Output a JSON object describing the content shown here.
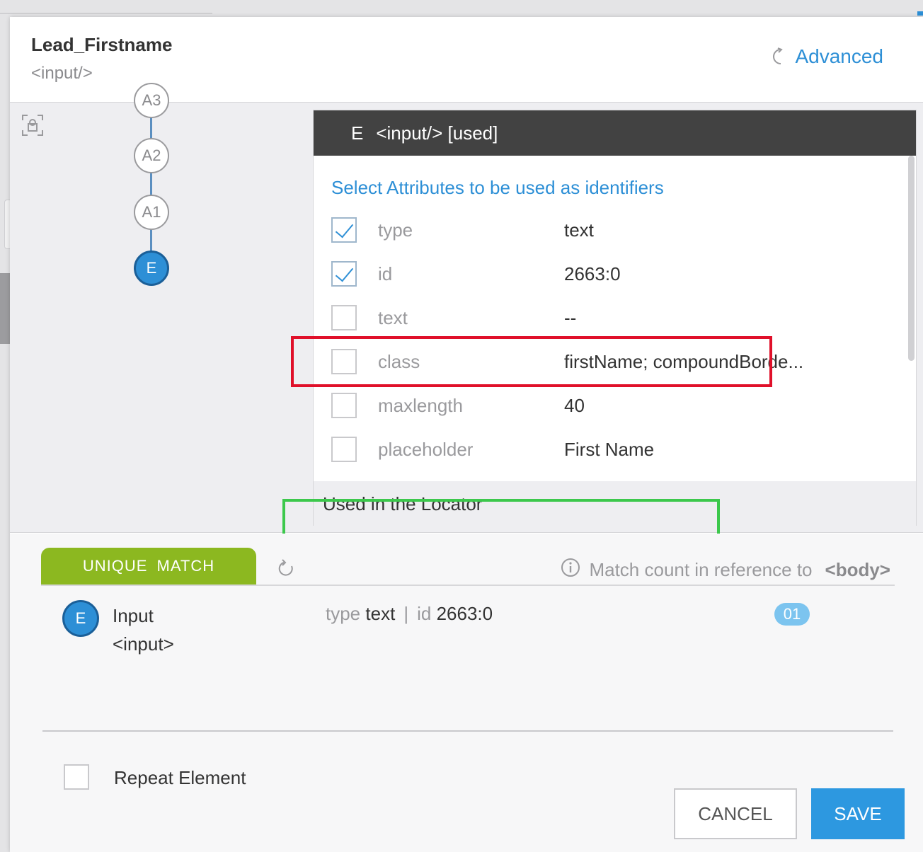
{
  "header": {
    "title": "Lead_Firstname",
    "subtitle": "<input/>",
    "advanced_label": "Advanced"
  },
  "tree": {
    "nodes": [
      {
        "label": "A3",
        "active": false
      },
      {
        "label": "A2",
        "active": false
      },
      {
        "label": "A1",
        "active": false
      },
      {
        "label": "E",
        "active": true
      }
    ]
  },
  "panel": {
    "header_node": "E",
    "header_text": "<input/> [used]",
    "section_title": "Select Attributes to be used as identifiers",
    "attributes": [
      {
        "name": "type",
        "value": "text",
        "checked": true
      },
      {
        "name": "id",
        "value": "2663:0",
        "checked": true
      },
      {
        "name": "text",
        "value": "--",
        "checked": false
      },
      {
        "name": "class",
        "value": "firstName; compoundBorde...",
        "checked": false
      },
      {
        "name": "maxlength",
        "value": "40",
        "checked": false
      },
      {
        "name": "placeholder",
        "value": "First Name",
        "checked": false
      }
    ],
    "footer_label": "Used in the Locator"
  },
  "match": {
    "tab_label": "UNIQUE  MATCH",
    "reference_text": "Match count in reference to",
    "reference_tag": "<body>",
    "result": {
      "node": "E",
      "name": "Input",
      "tag": "<input>",
      "attr1_key": "type",
      "attr1_val": "text",
      "separator": "|",
      "attr2_key": "id",
      "attr2_val": "2663:0",
      "count": "01"
    }
  },
  "footer": {
    "repeat_label": "Repeat Element",
    "cancel_label": "CANCEL",
    "save_label": "SAVE"
  },
  "colors": {
    "accent": "#2d8fd6",
    "match_green": "#8cb820",
    "highlight_red": "#e0102a",
    "highlight_green": "#3cc84c",
    "panel_header": "#424242"
  }
}
